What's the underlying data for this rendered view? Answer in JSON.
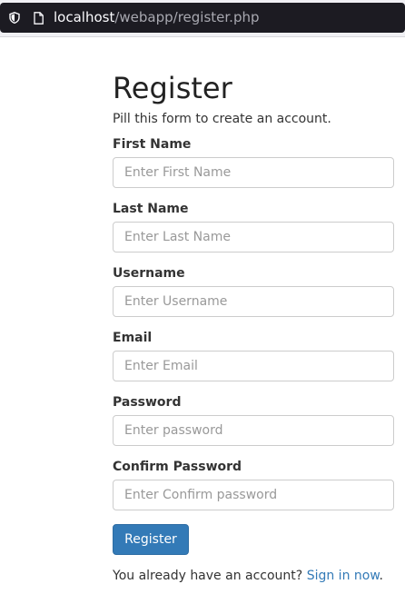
{
  "browser": {
    "url_host": "localhost",
    "url_path": "/webapp/register.php"
  },
  "form": {
    "title": "Register",
    "intro": "Pill this form to create an account.",
    "fields": [
      {
        "label": "First Name",
        "placeholder": "Enter First Name",
        "value": ""
      },
      {
        "label": "Last Name",
        "placeholder": "Enter Last Name",
        "value": ""
      },
      {
        "label": "Username",
        "placeholder": "Enter Username",
        "value": ""
      },
      {
        "label": "Email",
        "placeholder": "Enter Email",
        "value": ""
      },
      {
        "label": "Password",
        "placeholder": "Enter password",
        "value": ""
      },
      {
        "label": "Confirm Password",
        "placeholder": "Enter Confirm password",
        "value": ""
      }
    ],
    "submit_label": "Register",
    "signin_prefix": "You already have an account?",
    "signin_link": "Sign in now",
    "signin_suffix": "."
  },
  "colors": {
    "button": "#337ab7",
    "link": "#337ab7"
  }
}
